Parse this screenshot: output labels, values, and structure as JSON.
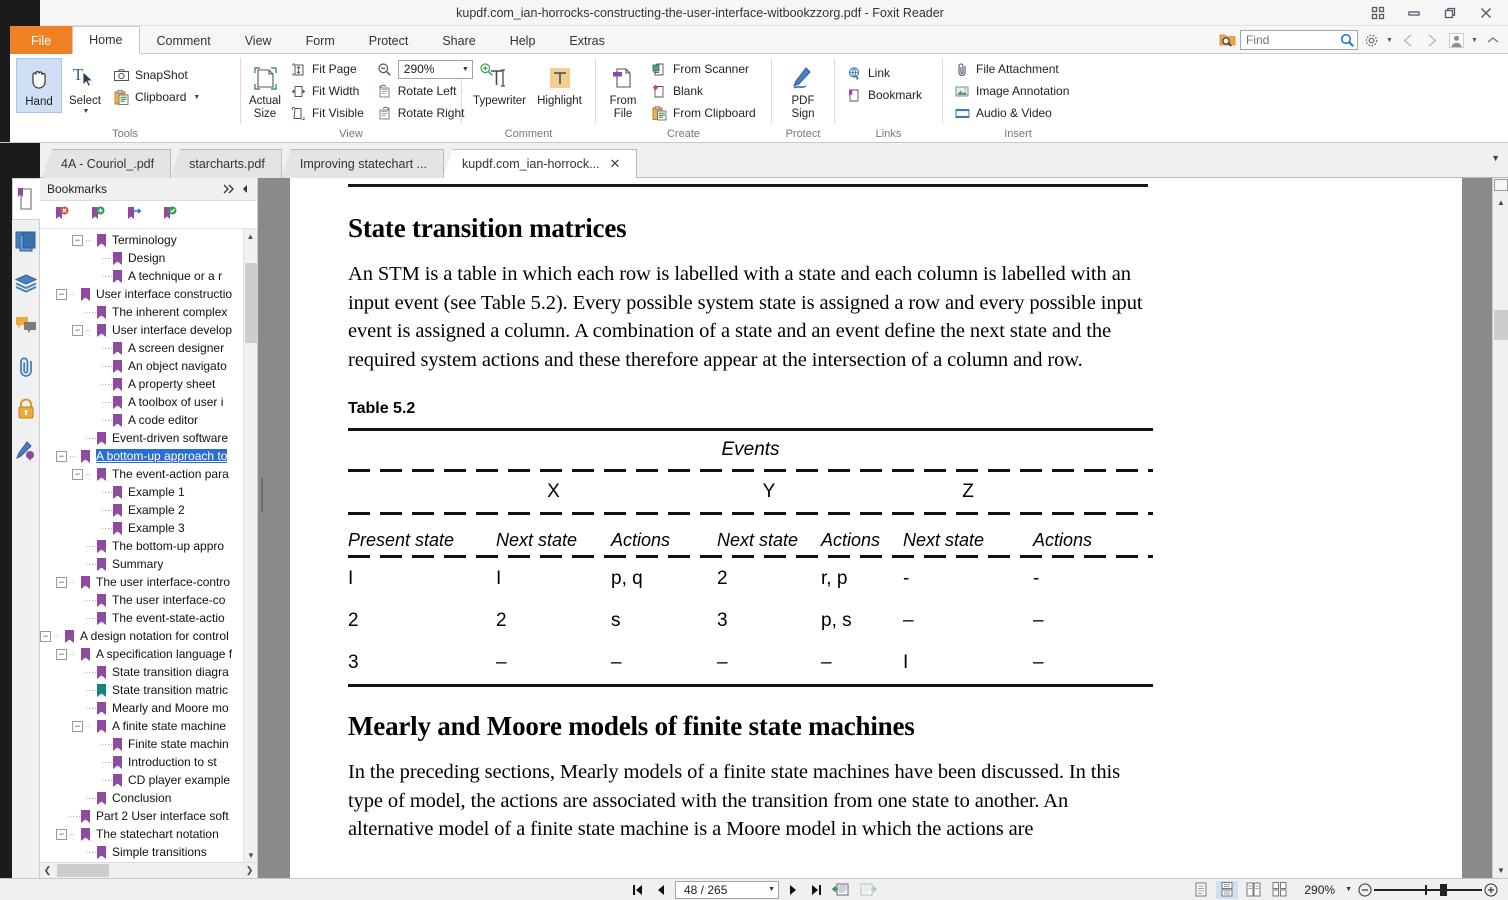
{
  "window": {
    "title": "kupdf.com_ian-horrocks-constructing-the-user-interface-witbookzzorg.pdf - Foxit Reader",
    "controls": [
      "restore-panels",
      "minimize",
      "maximize",
      "close"
    ]
  },
  "menu": {
    "tabs": [
      {
        "label": "File",
        "kind": "file"
      },
      {
        "label": "Home",
        "kind": "active"
      },
      {
        "label": "Comment",
        "kind": "normal"
      },
      {
        "label": "View",
        "kind": "normal"
      },
      {
        "label": "Form",
        "kind": "normal"
      },
      {
        "label": "Protect",
        "kind": "normal"
      },
      {
        "label": "Share",
        "kind": "normal"
      },
      {
        "label": "Help",
        "kind": "normal"
      },
      {
        "label": "Extras",
        "kind": "normal"
      }
    ],
    "find_placeholder": "Find"
  },
  "ribbon": {
    "groups": [
      {
        "title": "Tools",
        "big": [
          {
            "label": "Hand",
            "selected": true
          },
          {
            "label": "Select",
            "selected": false,
            "has_caret": true
          }
        ],
        "small": [
          {
            "label": "SnapShot",
            "icon": "camera-icon"
          },
          {
            "label": "Clipboard",
            "icon": "clipboard-icon",
            "caret": true
          }
        ]
      },
      {
        "title": "View",
        "big": [
          {
            "label": "Actual Size",
            "selected": false
          }
        ],
        "small": [
          {
            "label": "Fit Page",
            "icon": "fit-page-icon"
          },
          {
            "label": "Fit Width",
            "icon": "fit-width-icon"
          },
          {
            "label": "Fit Visible",
            "icon": "fit-visible-icon"
          }
        ],
        "small2": [
          {
            "label": "Rotate Left",
            "icon": "rotate-left-icon"
          },
          {
            "label": "Rotate Right",
            "icon": "rotate-right-icon"
          }
        ],
        "zoom_value": "290%"
      },
      {
        "title": "Comment",
        "big": [
          {
            "label": "Typewriter",
            "selected": false
          },
          {
            "label": "Highlight",
            "selected": false
          }
        ]
      },
      {
        "title": "Create",
        "big": [
          {
            "label": "From File",
            "selected": false
          }
        ],
        "small": [
          {
            "label": "From Scanner",
            "icon": "scanner-icon"
          },
          {
            "label": "Blank",
            "icon": "blank-page-icon"
          },
          {
            "label": "From Clipboard",
            "icon": "clipboard-icon"
          }
        ]
      },
      {
        "title": "Protect",
        "big": [
          {
            "label": "PDF Sign",
            "selected": false
          }
        ]
      },
      {
        "title": "Links",
        "small": [
          {
            "label": "Link",
            "icon": "link-globe-icon"
          },
          {
            "label": "Bookmark",
            "icon": "bookmark-page-icon"
          }
        ]
      },
      {
        "title": "Insert",
        "small": [
          {
            "label": "File Attachment",
            "icon": "paperclip-icon"
          },
          {
            "label": "Image Annotation",
            "icon": "image-icon"
          },
          {
            "label": "Audio & Video",
            "icon": "film-icon"
          }
        ]
      }
    ]
  },
  "doc_tabs": [
    {
      "label": "4A - Couriol_.pdf",
      "active": false,
      "closable": false
    },
    {
      "label": "starcharts.pdf",
      "active": false,
      "closable": false
    },
    {
      "label": "Improving statechart ...",
      "active": false,
      "closable": false
    },
    {
      "label": "kupdf.com_ian-horrock...",
      "active": true,
      "closable": true,
      "close_glyph": "✕"
    }
  ],
  "rail": [
    {
      "name": "bookmarks-panel-icon",
      "active": true
    },
    {
      "name": "pages-thumbnails-icon",
      "active": false
    },
    {
      "name": "layers-icon",
      "active": false
    },
    {
      "name": "comments-icon",
      "active": false
    },
    {
      "name": "attachments-icon",
      "active": false
    },
    {
      "name": "security-icon",
      "active": false
    },
    {
      "name": "digital-signature-icon",
      "active": false
    }
  ],
  "bookmarks": {
    "header": "Bookmarks",
    "toolbar_icons": [
      "bookmark-delete-icon",
      "bookmark-add-icon",
      "bookmark-goto-icon",
      "bookmark-verify-icon"
    ],
    "items": [
      {
        "label": "Terminology",
        "indent": 2,
        "twisty": "-"
      },
      {
        "label": "Design",
        "indent": 3,
        "twisty": ""
      },
      {
        "label": "A technique or a r",
        "indent": 3,
        "twisty": ""
      },
      {
        "label": "User interface constructio",
        "indent": 1,
        "twisty": "-"
      },
      {
        "label": "The inherent complex",
        "indent": 2,
        "twisty": ""
      },
      {
        "label": "User interface develop",
        "indent": 2,
        "twisty": "-"
      },
      {
        "label": "A screen designer",
        "indent": 3,
        "twisty": ""
      },
      {
        "label": "An object navigato",
        "indent": 3,
        "twisty": ""
      },
      {
        "label": "A property sheet",
        "indent": 3,
        "twisty": ""
      },
      {
        "label": "A toolbox of user i",
        "indent": 3,
        "twisty": ""
      },
      {
        "label": "A code editor",
        "indent": 3,
        "twisty": ""
      },
      {
        "label": "Event-driven software",
        "indent": 2,
        "twisty": ""
      },
      {
        "label": "A bottom-up approach to",
        "indent": 1,
        "twisty": "-",
        "selected": true
      },
      {
        "label": "The event-action para",
        "indent": 2,
        "twisty": "-"
      },
      {
        "label": "Example 1",
        "indent": 3,
        "twisty": ""
      },
      {
        "label": "Example 2",
        "indent": 3,
        "twisty": ""
      },
      {
        "label": "Example 3",
        "indent": 3,
        "twisty": ""
      },
      {
        "label": "The bottom-up appro",
        "indent": 2,
        "twisty": ""
      },
      {
        "label": "Summary",
        "indent": 2,
        "twisty": ""
      },
      {
        "label": "The user interface-contro",
        "indent": 1,
        "twisty": "-"
      },
      {
        "label": "The user interface-co",
        "indent": 2,
        "twisty": ""
      },
      {
        "label": "The event-state-actio",
        "indent": 2,
        "twisty": ""
      },
      {
        "label": "A design notation for control",
        "indent": 0,
        "twisty": "-"
      },
      {
        "label": "A specification language f",
        "indent": 1,
        "twisty": "-"
      },
      {
        "label": "State transition diagra",
        "indent": 2,
        "twisty": ""
      },
      {
        "label": "State transition matric",
        "indent": 2,
        "twisty": "",
        "current": true
      },
      {
        "label": "Mearly and Moore mo",
        "indent": 2,
        "twisty": ""
      },
      {
        "label": "A finite state machine",
        "indent": 2,
        "twisty": "-"
      },
      {
        "label": "Finite state machin",
        "indent": 3,
        "twisty": ""
      },
      {
        "label": "Introduction to st",
        "indent": 3,
        "twisty": ""
      },
      {
        "label": "CD player example",
        "indent": 3,
        "twisty": ""
      },
      {
        "label": "Conclusion",
        "indent": 2,
        "twisty": ""
      },
      {
        "label": "Part 2 User interface soft",
        "indent": 1,
        "twisty": ""
      },
      {
        "label": "The statechart notation",
        "indent": 1,
        "twisty": "-"
      },
      {
        "label": "Simple transitions",
        "indent": 2,
        "twisty": ""
      }
    ]
  },
  "document": {
    "heading1": "State transition matrices",
    "paragraph1": "An STM is a table in which each row is labelled with a state and each column is labelled with an input event (see Table 5.2). Every possible system state is assigned a row and every possible input event is assigned a column. A combination of a state and an event define the next state and the required system actions and these therefore appear at the intersection of a column and row.",
    "table_caption": "Table 5.2",
    "table": {
      "events_label": "Events",
      "event_columns": [
        "X",
        "Y",
        "Z"
      ],
      "headers": [
        "Present state",
        "Next state",
        "Actions",
        "Next state",
        "Actions",
        "Next state",
        "Actions"
      ],
      "rows": [
        [
          "I",
          "I",
          "p, q",
          "2",
          "r, p",
          "-",
          "-"
        ],
        [
          "2",
          "2",
          "s",
          "3",
          "p, s",
          "–",
          "–"
        ],
        [
          "3",
          "–",
          "–",
          "–",
          "–",
          "I",
          "–"
        ]
      ]
    },
    "heading2": "Mearly and Moore models of finite state machines",
    "paragraph2": "In the preceding sections, Mearly models of a finite state machines have been discussed. In this type of model, the actions are associated with the transition from one state to another. An alternative model of a finite state machine is a Moore model in which the actions are"
  },
  "statusbar": {
    "first_page_label": "first-page",
    "prev_page_label": "previous-page",
    "page_value": "48 / 265",
    "next_page_label": "next-page",
    "last_page_label": "last-page",
    "layout_modes": [
      "single-page",
      "continuous",
      "facing",
      "continuous-facing"
    ],
    "zoom_value": "290%"
  }
}
